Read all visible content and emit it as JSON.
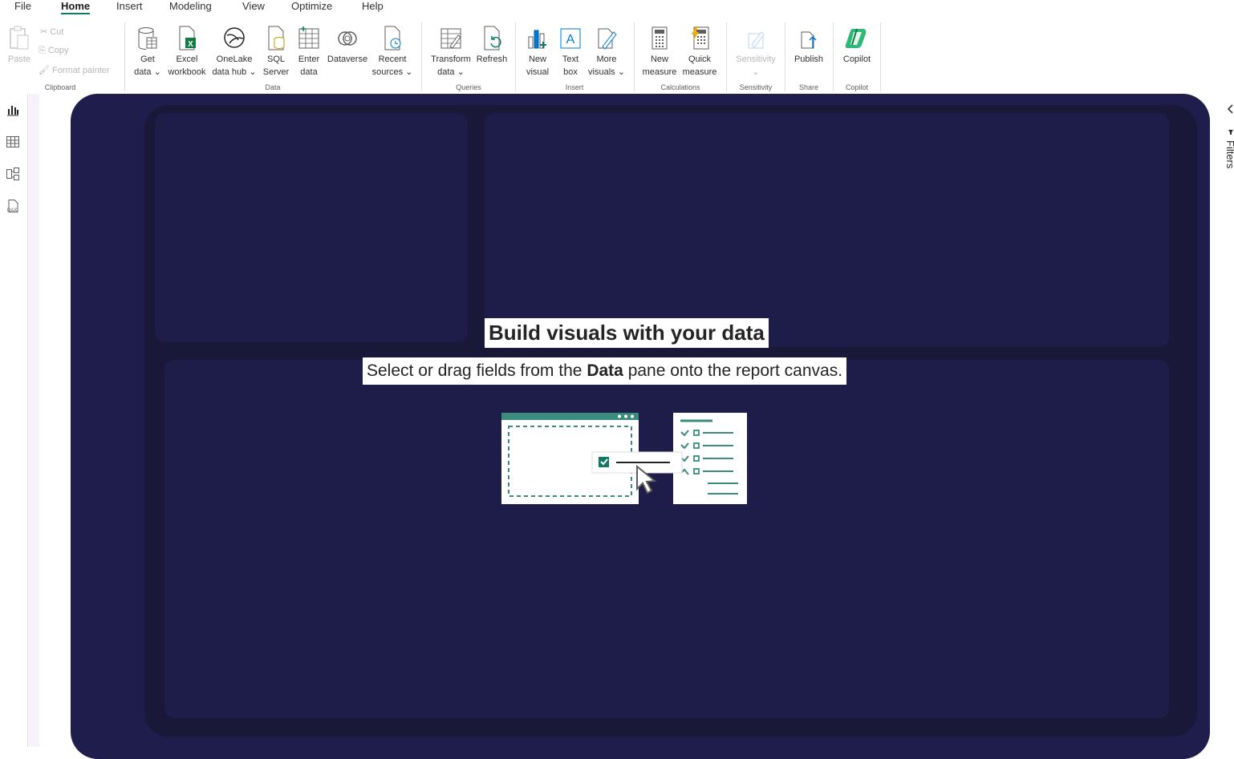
{
  "menu": {
    "tabs": [
      "File",
      "Home",
      "Insert",
      "Modeling",
      "View",
      "Optimize",
      "Help"
    ],
    "active": "Home"
  },
  "ribbon": {
    "clipboard": {
      "paste": "Paste",
      "cut": "Cut",
      "copy": "Copy",
      "format_painter": "Format painter",
      "group": "Clipboard"
    },
    "data": {
      "get_data_1": "Get",
      "get_data_2": "data",
      "excel_1": "Excel",
      "excel_2": "workbook",
      "onelake_1": "OneLake",
      "onelake_2": "data hub",
      "sql_1": "SQL",
      "sql_2": "Server",
      "enter_1": "Enter",
      "enter_2": "data",
      "dataverse": "Dataverse",
      "recent_1": "Recent",
      "recent_2": "sources",
      "group": "Data"
    },
    "queries": {
      "transform_1": "Transform",
      "transform_2": "data",
      "refresh": "Refresh",
      "group": "Queries"
    },
    "insert": {
      "new_visual_1": "New",
      "new_visual_2": "visual",
      "text_box_1": "Text",
      "text_box_2": "box",
      "more_visuals_1": "More",
      "more_visuals_2": "visuals",
      "group": "Insert"
    },
    "calculations": {
      "new_measure_1": "New",
      "new_measure_2": "measure",
      "quick_measure_1": "Quick",
      "quick_measure_2": "measure",
      "group": "Calculations"
    },
    "sensitivity": {
      "label": "Sensitivity",
      "group": "Sensitivity"
    },
    "share": {
      "publish": "Publish",
      "group": "Share"
    },
    "copilot": {
      "label": "Copilot",
      "group": "Copilot"
    }
  },
  "canvas": {
    "title": "Build visuals with your data",
    "subtitle_pre": "Select or drag fields from the",
    "subtitle_bold": "Data",
    "subtitle_post": "pane onto the report canvas."
  },
  "right_pane": {
    "label": "Filters"
  },
  "colors": {
    "accent": "#117865",
    "canvas": "#1f1d4b",
    "frame": "#191839"
  }
}
